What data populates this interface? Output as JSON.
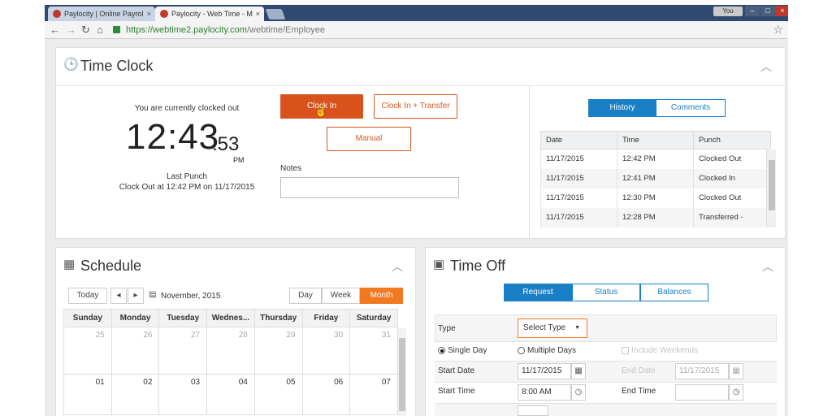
{
  "browser": {
    "tabs": [
      {
        "label": "Paylocity | Online Payrol",
        "close": "×"
      },
      {
        "label": "Paylocity - Web Time - M",
        "close": "×"
      }
    ],
    "user_button": "You",
    "window_controls": [
      "–",
      "□",
      "×"
    ],
    "url_host": "https://webtime2.paylocity.com",
    "url_path": "/webtime/Employee"
  },
  "time_clock": {
    "title": "Time Clock",
    "status": "You are currently clocked out",
    "time_main": "12:43",
    "time_seconds": ":53",
    "ampm": "PM",
    "last_punch_label": "Last Punch",
    "last_punch_detail": "Clock Out at 12:42 PM on 11/17/2015",
    "clock_in_label": "Clock In",
    "clock_in_transfer_label": "Clock In + Transfer",
    "manual_label": "Manual",
    "notes_label": "Notes",
    "history_tab": "History",
    "comments_tab": "Comments",
    "history_columns": [
      "Date",
      "Time",
      "Punch"
    ],
    "history_rows": [
      [
        "11/17/2015",
        "12:42 PM",
        "Clocked Out"
      ],
      [
        "11/17/2015",
        "12:41 PM",
        "Clocked In"
      ],
      [
        "11/17/2015",
        "12:30 PM",
        "Clocked Out"
      ],
      [
        "11/17/2015",
        "12:28 PM",
        "Transferred -"
      ]
    ]
  },
  "schedule": {
    "title": "Schedule",
    "today_label": "Today",
    "prev": "◂",
    "next": "▸",
    "month_label": "November, 2015",
    "views": [
      "Day",
      "Week",
      "Month"
    ],
    "active_view": "Month",
    "weekdays": [
      "Sunday",
      "Monday",
      "Tuesday",
      "Wednes...",
      "Thursday",
      "Friday",
      "Saturday"
    ],
    "week1": [
      "25",
      "26",
      "27",
      "28",
      "29",
      "30",
      "31"
    ],
    "week2": [
      "01",
      "02",
      "03",
      "04",
      "05",
      "06",
      "07"
    ]
  },
  "time_off": {
    "title": "Time Off",
    "tabs": [
      "Request",
      "Status",
      "Balances"
    ],
    "active_tab": "Request",
    "type_label": "Type",
    "type_value": "Select Type",
    "single_day_label": "Single Day",
    "multiple_days_label": "Multiple Days",
    "include_weekends_label": "Include Weekends",
    "start_date_label": "Start Date",
    "start_date_value": "11/17/2015",
    "end_date_label": "End Date",
    "end_date_value": "11/17/2015",
    "start_time_label": "Start Time",
    "start_time_value": "8:00 AM",
    "end_time_label": "End Time",
    "end_time_value": ""
  },
  "colors": {
    "accent_orange": "#d9521b",
    "accent_blue": "#1a7fc4",
    "tab_bar": "#2f4a6e"
  }
}
